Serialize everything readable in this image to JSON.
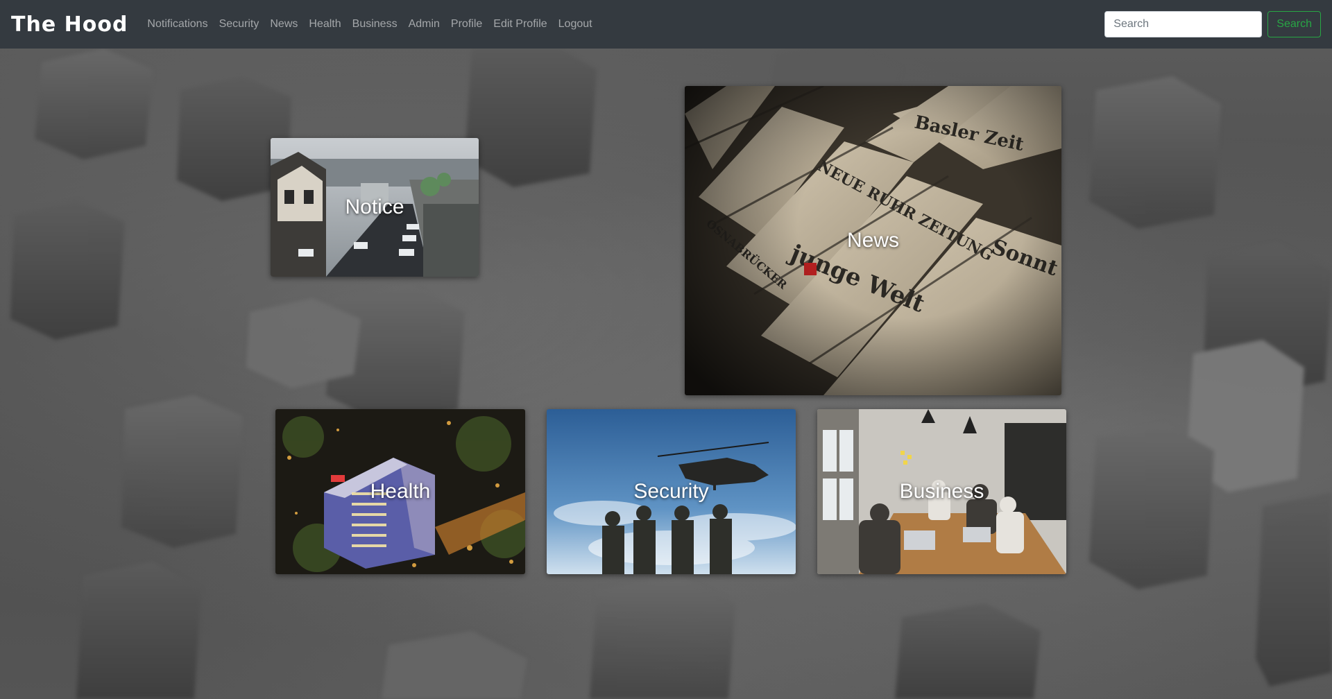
{
  "navbar": {
    "brand": "The Hood",
    "links": [
      "Notifications",
      "Security",
      "News",
      "Health",
      "Business",
      "Admin",
      "Profile",
      "Edit Profile",
      "Logout"
    ],
    "search_placeholder": "Search",
    "search_button": "Search"
  },
  "cards": {
    "notice": "Notice",
    "news": "News",
    "health": "Health",
    "security": "Security",
    "business": "Business"
  },
  "colors": {
    "navbar_bg": "#343a40",
    "search_button": "#28a745"
  }
}
